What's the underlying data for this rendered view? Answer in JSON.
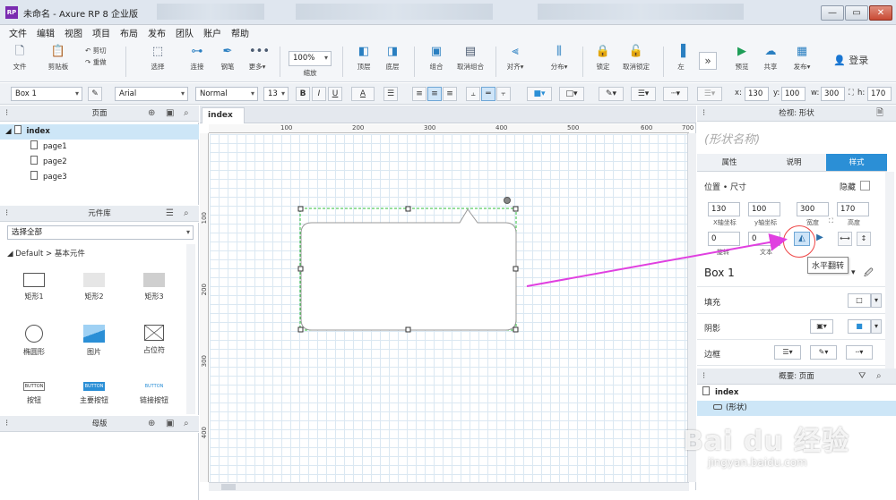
{
  "app": {
    "logo": "RP",
    "title": "未命名 - Axure RP 8 企业版"
  },
  "window": {
    "minimize": "—",
    "maximize": "▭",
    "close": "✕"
  },
  "menu": [
    "文件",
    "编辑",
    "视图",
    "项目",
    "布局",
    "发布",
    "团队",
    "账户",
    "帮助"
  ],
  "toolbar": {
    "file": "文件",
    "clipboard": "剪贴板",
    "cut": "剪切",
    "redo": "重做",
    "select": "选择",
    "connect": "连接",
    "pen": "钢笔",
    "more": "更多▾",
    "zoom": "100%",
    "zoom_label": "缩放",
    "top": "顶层",
    "bottom": "底层",
    "group": "组合",
    "ungroup": "取消组合",
    "align": "对齐▾",
    "distribute": "分布▾",
    "lock": "锁定",
    "unlock": "取消锁定",
    "left": "左",
    "preview": "预览",
    "share": "共享",
    "publish": "发布▾",
    "login": "登录"
  },
  "format": {
    "shape_name": "Box 1",
    "font": "Arial",
    "style": "Normal",
    "size": "13",
    "bold": "B",
    "italic": "I",
    "underline": "U",
    "font_color": "A",
    "x_label": "x:",
    "x": "130",
    "y_label": "y:",
    "y": "100",
    "w_label": "w:",
    "w": "300",
    "h_label": "h:",
    "h": "170"
  },
  "pages_panel": {
    "title": "页面",
    "items": [
      {
        "label": "index",
        "selected": true
      },
      {
        "label": "page1"
      },
      {
        "label": "page2"
      },
      {
        "label": "page3"
      }
    ]
  },
  "library_panel": {
    "title": "元件库",
    "filter": "选择全部",
    "group": "Default > 基本元件",
    "widgets": [
      "矩形1",
      "矩形2",
      "矩形3",
      "椭圆形",
      "图片",
      "占位符",
      "按钮",
      "主要按钮",
      "链接按钮"
    ],
    "button_text": "BUTTON"
  },
  "masters_panel": {
    "title": "母版"
  },
  "canvas": {
    "tab": "index",
    "tab_close": "×",
    "ruler_h": [
      "100",
      "200",
      "300",
      "400",
      "500",
      "600",
      "700"
    ],
    "ruler_v": [
      "100",
      "200",
      "300",
      "400"
    ]
  },
  "inspector": {
    "title": "检视: 形状",
    "name_placeholder": "(形状名称)",
    "tabs": [
      "属性",
      "说明",
      "样式"
    ],
    "section": "位置 • 尺寸",
    "hidden": "隐藏",
    "x": "130",
    "y": "100",
    "w": "300",
    "h": "170",
    "x_label": "X轴坐标",
    "y_label": "y轴坐标",
    "w_label": "宽度",
    "h_label": "高度",
    "rotation": "0",
    "text_rotation": "0",
    "rotation_label": "旋转",
    "text_label": "文本",
    "tooltip": "水平翻转",
    "style_name": "Box 1",
    "fill": "填充",
    "shadow": "阴影",
    "border": "边框"
  },
  "outline": {
    "title": "概要: 页面",
    "page": "index",
    "shape": "(形状)"
  },
  "watermark": {
    "text": "Bai du 经验",
    "url": "jingyan.baidu.com"
  },
  "colors": {
    "accent": "#2b8fd6",
    "arrow": "#e040e0",
    "selection": "#2fbf3a"
  }
}
